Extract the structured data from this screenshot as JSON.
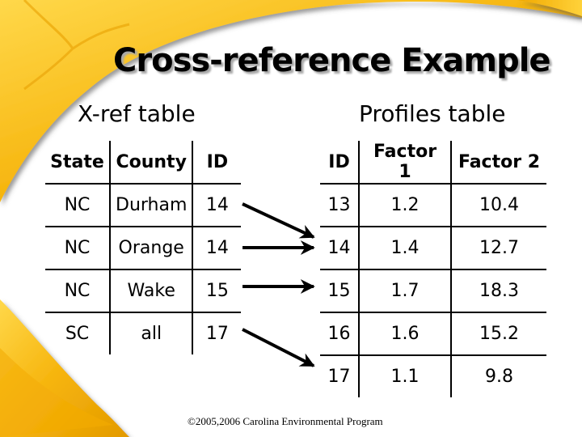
{
  "slide": {
    "title": "Cross-reference Example",
    "footer": "©2005,2006 Carolina Environmental Program",
    "accent_color": "#f2b705"
  },
  "xref_table": {
    "caption": "X-ref table",
    "headers": [
      "State",
      "County",
      "ID"
    ],
    "rows": [
      [
        "NC",
        "Durham",
        "14"
      ],
      [
        "NC",
        "Orange",
        "14"
      ],
      [
        "NC",
        "Wake",
        "15"
      ],
      [
        "SC",
        "all",
        "17"
      ]
    ]
  },
  "profiles_table": {
    "caption": "Profiles table",
    "headers": [
      "ID",
      "Factor 1",
      "Factor 2"
    ],
    "rows": [
      [
        "13",
        "1.2",
        "10.4"
      ],
      [
        "14",
        "1.4",
        "12.7"
      ],
      [
        "15",
        "1.7",
        "18.3"
      ],
      [
        "16",
        "1.6",
        "15.2"
      ],
      [
        "17",
        "1.1",
        "9.8"
      ]
    ]
  },
  "arrows": [
    {
      "from_xref_row": 1,
      "to_profile_row": 2,
      "label": "Durham 14 → 14"
    },
    {
      "from_xref_row": 2,
      "to_profile_row": 2,
      "label": "Orange 14 → 14"
    },
    {
      "from_xref_row": 3,
      "to_profile_row": 3,
      "label": "Wake 15 → 15"
    },
    {
      "from_xref_row": 4,
      "to_profile_row": 5,
      "label": "all 17 → 17"
    }
  ]
}
